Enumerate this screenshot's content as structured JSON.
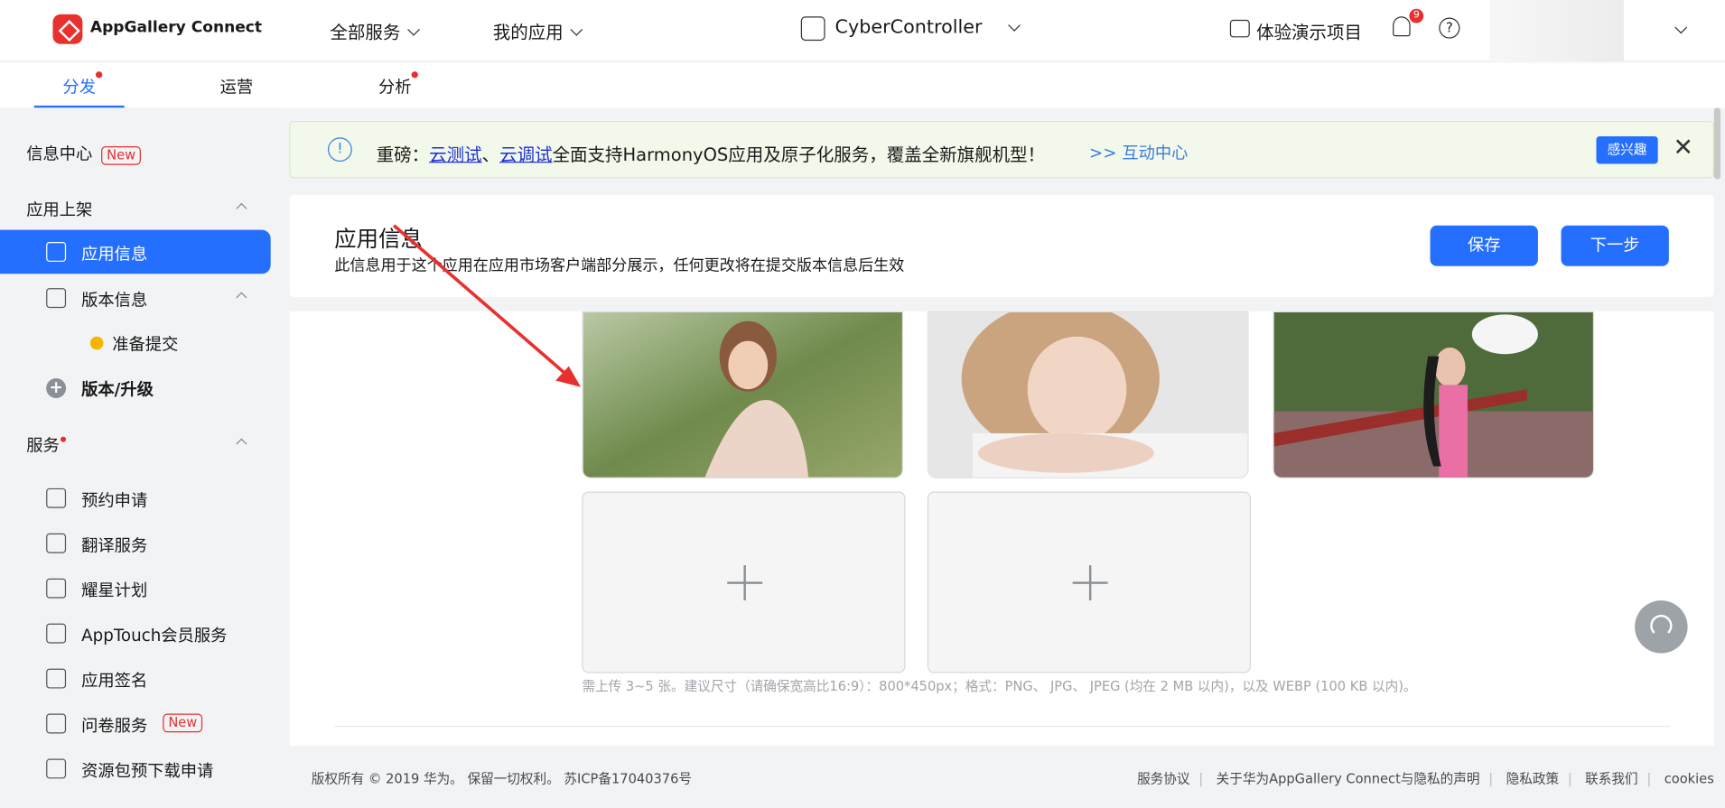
{
  "topbar": {
    "brand": "AppGallery Connect",
    "menu_all_services": "全部服务",
    "menu_my_apps": "我的应用",
    "app_name": "CyberController",
    "demo_project": "体验演示项目",
    "notification_count": "9",
    "help": "?"
  },
  "tabs": [
    {
      "label": "分发",
      "active": true,
      "dot": true
    },
    {
      "label": "运营",
      "active": false,
      "dot": false
    },
    {
      "label": "分析",
      "active": false,
      "dot": true
    }
  ],
  "sidebar": {
    "info_center": "信息中心",
    "new_tag": "New",
    "group_listing": "应用上架",
    "app_info": "应用信息",
    "version_info": "版本信息",
    "ready_submit": "准备提交",
    "version_upgrade": "版本/升级",
    "group_services": "服务",
    "items": [
      {
        "label": "预约申请",
        "icon": "calendar-clock-icon"
      },
      {
        "label": "翻译服务",
        "icon": "translate-icon"
      },
      {
        "label": "耀星计划",
        "icon": "star-badge-icon"
      },
      {
        "label": "AppTouch会员服务",
        "icon": "members-icon"
      },
      {
        "label": "应用签名",
        "icon": "signature-icon"
      },
      {
        "label": "问卷服务",
        "icon": "checklist-icon",
        "new": true
      },
      {
        "label": "资源包预下载申请",
        "icon": "package-icon"
      }
    ]
  },
  "banner": {
    "prefix": "重磅：",
    "link1": "云测试",
    "sep": "、",
    "link2": "云调试",
    "rest": "全面支持HarmonyOS应用及原子化服务，覆盖全新旗舰机型！",
    "hub": ">> 互动中心",
    "interest_button": "感兴趣",
    "close": "✕"
  },
  "header": {
    "title": "应用信息",
    "subtitle": "此信息用于这个应用在应用市场客户端部分展示，任何更改将在提交版本信息后生效",
    "save": "保存",
    "next": "下一步"
  },
  "screenshots": {
    "hint": "需上传 3~5 张。建议尺寸（请确保宽高比16:9）：800*450px；格式：PNG、 JPG、 JPEG (均在 2 MB 以内)，以及 WEBP (100 KB 以内)。"
  },
  "footer": {
    "copyright": "版权所有 © 2019 华为。 保留一切权利。 苏ICP备17040376号",
    "links": [
      "服务协议",
      "关于华为AppGallery Connect与隐私的声明",
      "隐私政策",
      "联系我们",
      "cookies"
    ]
  },
  "colors": {
    "accent": "#256fff",
    "alert": "#e8302f",
    "banner_bg": "#f2f9ea"
  }
}
